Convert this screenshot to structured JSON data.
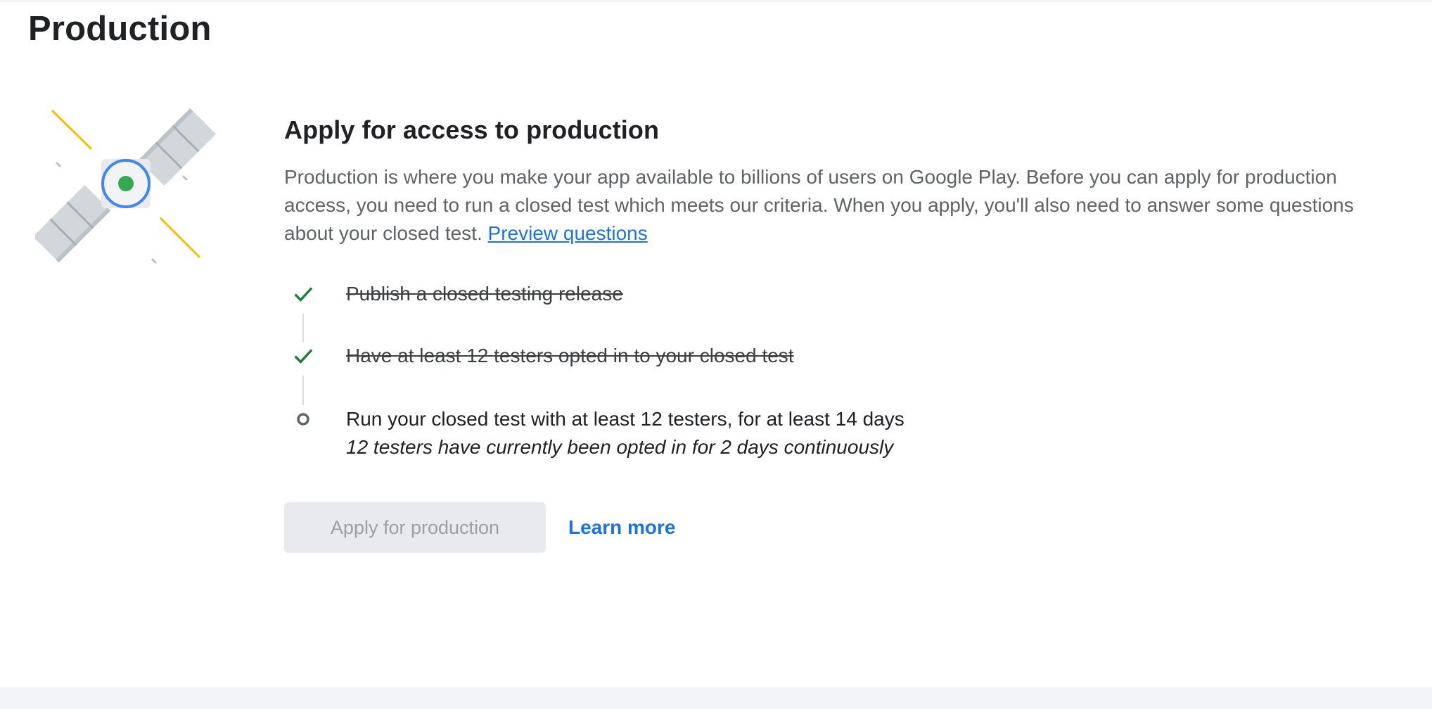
{
  "page": {
    "title": "Production"
  },
  "card": {
    "heading": "Apply for access to production",
    "description": "Production is where you make your app available to billions of users on Google Play. Before you can apply for production access, you need to run a closed test which meets our criteria. When you apply, you'll also need to answer some questions about your closed test.",
    "preview_link": "Preview questions",
    "illustration_icon": "satellite-icon"
  },
  "checklist": [
    {
      "label": "Publish a closed testing release",
      "status": "complete",
      "icon": "check-icon"
    },
    {
      "label": "Have at least 12 testers opted in to your closed test",
      "status": "complete",
      "icon": "check-icon"
    },
    {
      "label": "Run your closed test with at least 12 testers, for at least 14 days",
      "status": "in-progress",
      "icon": "pending-circle-icon",
      "note": "12 testers have currently been opted in for 2 days continuously"
    }
  ],
  "actions": {
    "apply_label": "Apply for production",
    "apply_disabled": true,
    "learn_more_label": "Learn more"
  },
  "colors": {
    "accent_link": "#1a73e8",
    "check_green": "#188038",
    "satellite_green": "#34a853",
    "satellite_blue": "#4285f4",
    "ray_yellow": "#fbbc04",
    "panel_gray": "#d2d7db",
    "disabled_button_bg": "#e8eaed"
  }
}
